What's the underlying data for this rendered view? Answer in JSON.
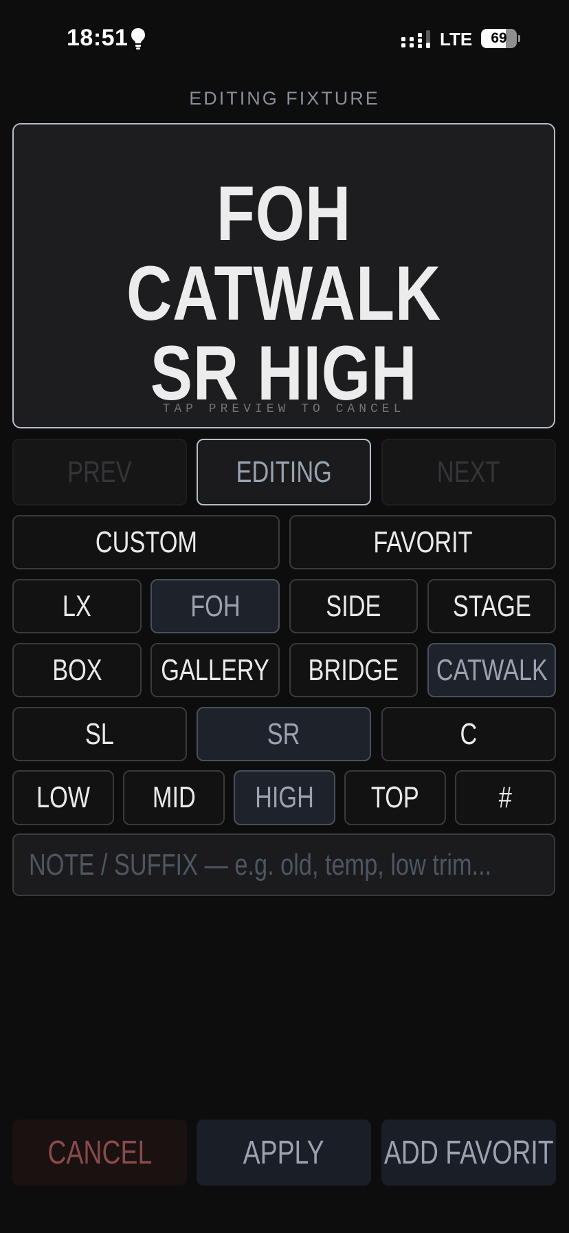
{
  "status_bar": {
    "time": "18:51",
    "network": "LTE",
    "battery": "69",
    "battery_level": 0.69
  },
  "header": {
    "label": "EDITING FIXTURE"
  },
  "preview": {
    "line1": "FOH CATWALK",
    "line2": "SR HIGH",
    "hint": "TAP PREVIEW TO CANCEL"
  },
  "nav": {
    "prev": "PREV",
    "editing": "EDITING",
    "next": "NEXT"
  },
  "mode": {
    "custom": "CUSTOM",
    "favorit": "FAVORIT"
  },
  "row_position": [
    "LX",
    "FOH",
    "SIDE",
    "STAGE"
  ],
  "row_location": [
    "BOX",
    "GALLERY",
    "BRIDGE",
    "CATWALK"
  ],
  "row_side": [
    "SL",
    "SR",
    "C"
  ],
  "row_height": [
    "LOW",
    "MID",
    "HIGH",
    "TOP",
    "#"
  ],
  "note": {
    "placeholder": "NOTE / SUFFIX — e.g. old, temp, low trim..."
  },
  "actions": {
    "cancel": "CANCEL",
    "apply": "APPLY",
    "add_favorit": "ADD FAVORIT"
  },
  "colors": {
    "accent": "#b6bec9",
    "selected_bg": "#1e222b",
    "cancel_text": "#8a4a4a"
  }
}
